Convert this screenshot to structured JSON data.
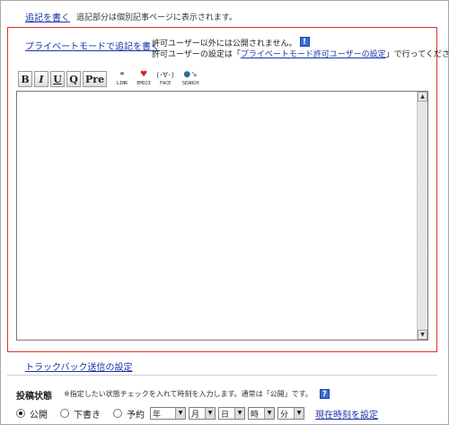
{
  "top": {
    "append_link": "追記を書く",
    "append_note": "追記部分は個別記事ページに表示されます。"
  },
  "private": {
    "link": "プライベートモードで追記を書く",
    "info_line1": "許可ユーザー以外には公開されません。",
    "info_line2_prefix": "許可ユーザーの設定は「",
    "info_line2_link": "プライベートモード許可ユーザーの設定",
    "info_line2_suffix": "」で行ってください。",
    "help_icon_glyph": "!"
  },
  "toolbar": {
    "bold": "B",
    "italic": "I",
    "underline": "U",
    "quote": "Q",
    "pre": "Pre",
    "link_caption": "LINK",
    "emoji_caption": "EMOJI",
    "face_caption": "FACE",
    "search_caption": "SEARCH",
    "face_glyph": "(･∀･)"
  },
  "editor": {
    "value": ""
  },
  "trackback": {
    "link": "トラックバック送信の設定"
  },
  "status": {
    "title": "投稿状態",
    "note": "※指定したい状態チェックを入れて時刻を入力します。通常は「公開」です。",
    "help_icon_glyph": "?",
    "options": [
      "公開",
      "下書き",
      "予約"
    ],
    "selected": "公開",
    "year": "年",
    "month": "月",
    "day": "日",
    "hour": "時",
    "minute": "分",
    "now_link": "現在時刻を設定"
  },
  "colors": {
    "link": "#1a33a8",
    "private_border": "#e03030",
    "help_icon": "#3a6ad6"
  }
}
